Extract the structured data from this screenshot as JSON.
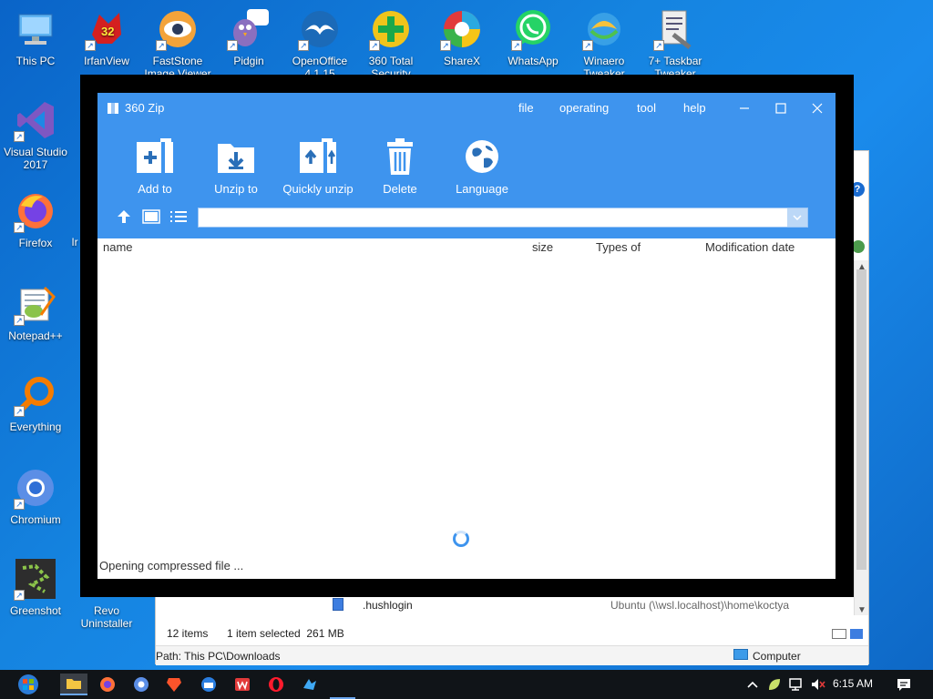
{
  "desktop": {
    "icons": [
      {
        "label": "This PC"
      },
      {
        "label": "IrfanView"
      },
      {
        "label": "FastStone Image Viewer"
      },
      {
        "label": "Pidgin"
      },
      {
        "label": "OpenOffice 4.1.15"
      },
      {
        "label": "360 Total Security"
      },
      {
        "label": "ShareX"
      },
      {
        "label": "WhatsApp"
      },
      {
        "label": "Winaero Tweaker"
      },
      {
        "label": "7+ Taskbar Tweaker"
      },
      {
        "label": "Visual Studio 2017"
      },
      {
        "label": "Firefox"
      },
      {
        "label": "Notepad++"
      },
      {
        "label": "Everything"
      },
      {
        "label": "Chromium"
      },
      {
        "label": "Greenshot"
      },
      {
        "label": "Revo Uninstaller"
      },
      {
        "label": "Ir"
      }
    ]
  },
  "explorer": {
    "file_name": ".hushlogin",
    "file_location": "Ubuntu (\\\\wsl.localhost)\\home\\koctya",
    "status_items": "12 items",
    "status_selected": "1 item selected  261 MB",
    "path": "Path: This PC\\Downloads",
    "computer": "Computer"
  },
  "zip": {
    "title": "360 Zip",
    "menu": {
      "file": "file",
      "operating": "operating",
      "tool": "tool",
      "help": "help"
    },
    "toolbar": {
      "add": "Add to",
      "unzip": "Unzip to",
      "quick": "Quickly unzip",
      "delete": "Delete",
      "language": "Language"
    },
    "path_value": "",
    "columns": {
      "name": "name",
      "size": "size",
      "type": "Types of",
      "date": "Modification date"
    },
    "loading": "Opening compressed file ..."
  },
  "taskbar": {
    "time": "6:15 AM"
  },
  "colors": {
    "accent": "#3e94ee",
    "desktop": "#1584e0",
    "taskbar": "#101418"
  }
}
